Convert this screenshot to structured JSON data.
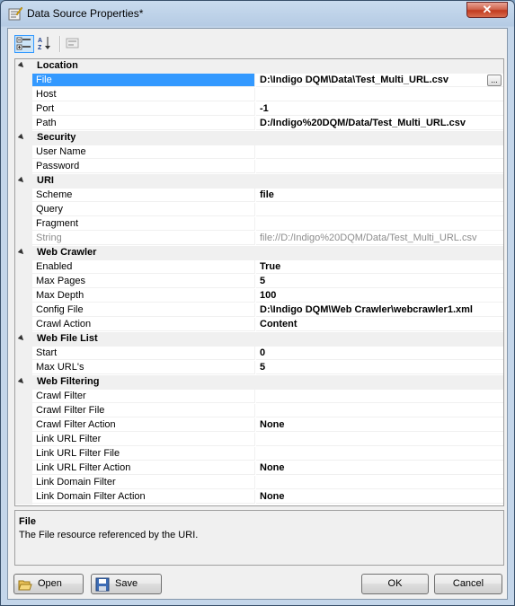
{
  "window": {
    "title": "Data Source Properties*"
  },
  "toolbar": {
    "categorized": "categorized-icon",
    "alphabetical": "alphabetical-icon",
    "property_pages": "property-pages-icon"
  },
  "grid": {
    "categories": [
      {
        "label": "Location",
        "props": [
          {
            "name": "File",
            "value": "D:\\Indigo DQM\\Data\\Test_Multi_URL.csv"
          },
          {
            "name": "Host",
            "value": ""
          },
          {
            "name": "Port",
            "value": "-1"
          },
          {
            "name": "Path",
            "value": "D:/Indigo%20DQM/Data/Test_Multi_URL.csv"
          }
        ]
      },
      {
        "label": "Security",
        "props": [
          {
            "name": "User Name",
            "value": ""
          },
          {
            "name": "Password",
            "value": ""
          }
        ]
      },
      {
        "label": "URI",
        "props": [
          {
            "name": "Scheme",
            "value": "file"
          },
          {
            "name": "Query",
            "value": ""
          },
          {
            "name": "Fragment",
            "value": ""
          },
          {
            "name": "String",
            "value": "file://D:/Indigo%20DQM/Data/Test_Multi_URL.csv"
          }
        ]
      },
      {
        "label": "Web Crawler",
        "props": [
          {
            "name": "Enabled",
            "value": "True"
          },
          {
            "name": "Max Pages",
            "value": "5"
          },
          {
            "name": "Max Depth",
            "value": "100"
          },
          {
            "name": "Config File",
            "value": "D:\\Indigo DQM\\Web Crawler\\webcrawler1.xml"
          },
          {
            "name": "Crawl Action",
            "value": "Content"
          }
        ]
      },
      {
        "label": "Web File List",
        "props": [
          {
            "name": "Start",
            "value": "0"
          },
          {
            "name": "Max URL's",
            "value": "5"
          }
        ]
      },
      {
        "label": "Web Filtering",
        "props": [
          {
            "name": "Crawl Filter",
            "value": ""
          },
          {
            "name": "Crawl Filter File",
            "value": ""
          },
          {
            "name": "Crawl Filter Action",
            "value": "None"
          },
          {
            "name": "Link URL Filter",
            "value": ""
          },
          {
            "name": "Link URL Filter File",
            "value": ""
          },
          {
            "name": "Link URL Filter Action",
            "value": "None"
          },
          {
            "name": "Link Domain Filter",
            "value": ""
          },
          {
            "name": "Link Domain Filter Action",
            "value": "None"
          }
        ]
      }
    ],
    "ellipsis_label": "..."
  },
  "description": {
    "title": "File",
    "text": "The File resource referenced by the URI."
  },
  "buttons": {
    "open": "Open",
    "save": "Save",
    "ok": "OK",
    "cancel": "Cancel"
  },
  "colors": {
    "selection": "#3399ff",
    "close": "#c23b1f"
  }
}
